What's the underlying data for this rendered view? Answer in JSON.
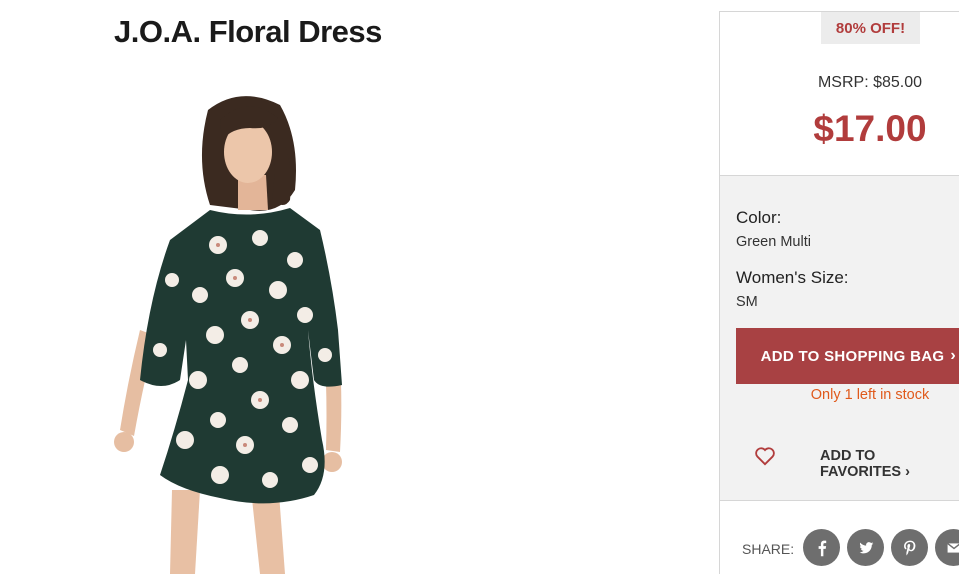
{
  "product": {
    "title": "J.O.A. Floral Dress"
  },
  "pricing": {
    "discount_badge": "80% OFF!",
    "msrp": "MSRP: $85.00",
    "price": "$17.00"
  },
  "options": {
    "color_label": "Color:",
    "color_value": "Green Multi",
    "size_label": "Women's Size:",
    "size_value": "SM"
  },
  "actions": {
    "add_to_bag": "ADD TO SHOPPING BAG",
    "add_to_bag_chevron": "›",
    "stock_note": "Only 1 left in stock",
    "add_to_favorites": "ADD TO FAVORITES ›"
  },
  "share": {
    "label": "SHARE:",
    "icons": [
      "facebook-icon",
      "twitter-icon",
      "pinterest-icon",
      "email-icon"
    ]
  },
  "colors": {
    "accent": "#b13c3c",
    "button": "#a84143",
    "stock": "#e05a1c",
    "dress": "#1f3a33"
  }
}
